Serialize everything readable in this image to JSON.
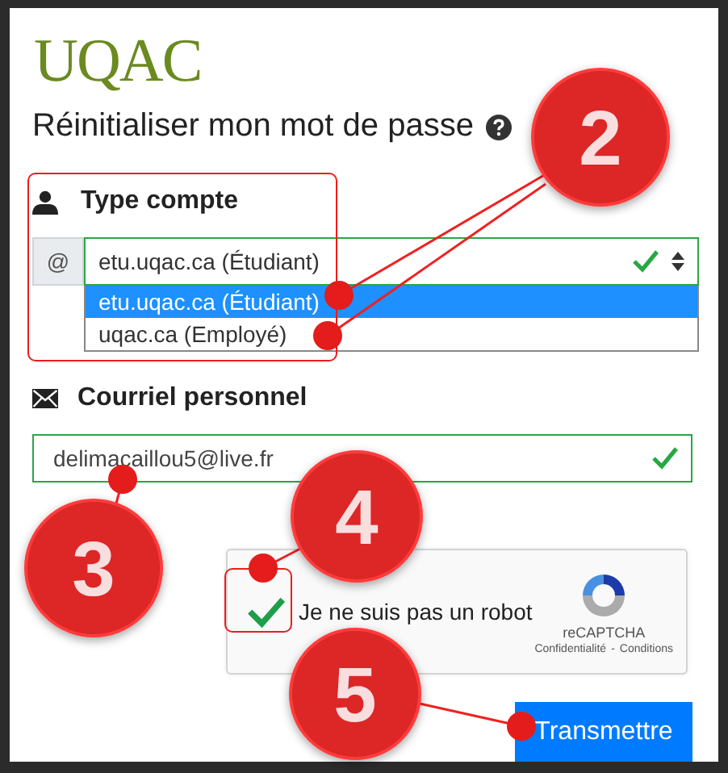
{
  "logo": {
    "text": "UQAC"
  },
  "title": "Réinitialiser mon mot de passe",
  "account_type": {
    "label": "Type compte",
    "addon": "@",
    "value": "etu.uqac.ca (Étudiant)",
    "valid": true,
    "expanded": true,
    "options": [
      {
        "label": "etu.uqac.ca (Étudiant)",
        "selected": true
      },
      {
        "label": "uqac.ca (Employé)",
        "selected": false
      }
    ]
  },
  "email": {
    "label": "Courriel personnel",
    "value": "delimacaillou5@live.fr",
    "valid": true
  },
  "captcha": {
    "label": "Je ne suis pas un robot",
    "checked": true,
    "brand": "reCAPTCHA",
    "links": [
      "Confidentialité",
      "Conditions"
    ],
    "separator": "-"
  },
  "submit": {
    "label": "Transmettre"
  },
  "callouts": [
    {
      "label": "2"
    },
    {
      "label": "3"
    },
    {
      "label": "4"
    },
    {
      "label": "5"
    }
  ]
}
